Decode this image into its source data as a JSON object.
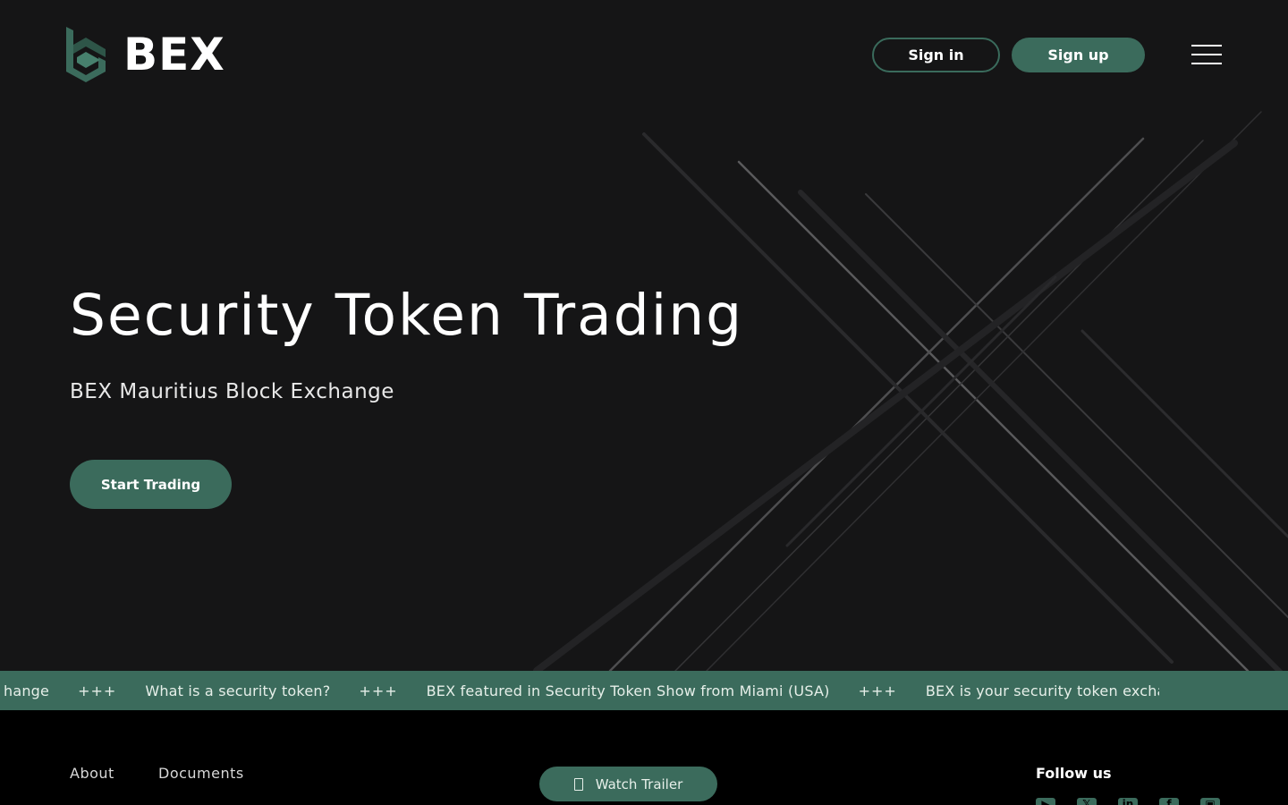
{
  "brand": {
    "name": "BEX"
  },
  "header": {
    "signin_label": "Sign in",
    "signup_label": "Sign up"
  },
  "hero": {
    "title": "Security Token Trading",
    "subtitle": "BEX Mauritius Block Exchange",
    "cta_label": "Start Trading"
  },
  "ticker": {
    "separator": "+++",
    "items": [
      "hange",
      "What is a security token?",
      "BEX featured in Security Token Show from Miami (USA)",
      "BEX is your security token exchange"
    ]
  },
  "footer": {
    "links": [
      "About",
      "Documents"
    ],
    "trailer_label": "Watch Trailer",
    "follow_label": "Follow us",
    "social_icons": [
      "youtube-icon",
      "x-icon",
      "linkedin-icon",
      "facebook-icon",
      "instagram-icon"
    ]
  },
  "colors": {
    "background": "#151516",
    "accent": "#3b6b5c",
    "footer": "#000000"
  }
}
